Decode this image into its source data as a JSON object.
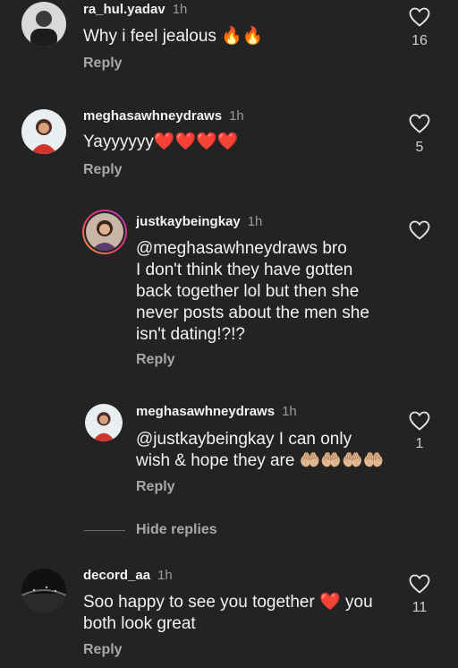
{
  "comments": [
    {
      "username": "ra_hul.yadav",
      "time": "1h",
      "text": "Why i feel jealous 🔥🔥",
      "reply_label": "Reply",
      "likes": "16"
    },
    {
      "username": "meghasawhneydraws",
      "time": "1h",
      "text": "Yayyyyyy❤️❤️❤️❤️",
      "reply_label": "Reply",
      "likes": "5"
    },
    {
      "username": "justkaybeingkay",
      "time": "1h",
      "text_lines": [
        "@meghasawhneydraws bro",
        "I don't think they have gotten",
        "back together lol but then she",
        "never posts about the men she",
        "isn't dating!?!?"
      ],
      "reply_label": "Reply",
      "likes": ""
    },
    {
      "username": "meghasawhneydraws",
      "time": "1h",
      "text_lines": [
        "@justkaybeingkay I can only",
        "wish & hope they are 🤲🏼🤲🏼🤲🏼🤲🏼"
      ],
      "reply_label": "Reply",
      "likes": "1"
    },
    {
      "username": "decord_aa",
      "time": "1h",
      "text_lines": [
        "Soo happy to see you together ❤️ you",
        "both look great"
      ],
      "reply_label": "Reply",
      "likes": "11"
    }
  ],
  "hide_replies_label": "Hide replies",
  "colors": {
    "background": "#232324",
    "heart_red": "#e8323c",
    "muted": "#a8a8a8"
  }
}
